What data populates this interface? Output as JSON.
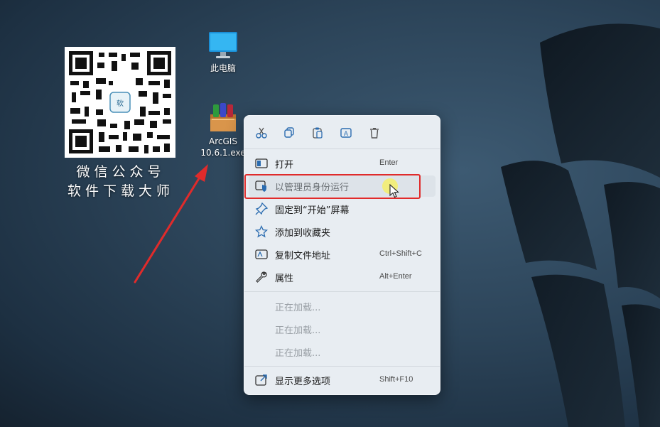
{
  "desktop": {
    "icons": [
      {
        "label": "此电脑"
      },
      {
        "label_line1": "ArcGIS",
        "label_line2": "10.6.1.exe"
      }
    ],
    "qr_caption_line1": "微信公众号",
    "qr_caption_line2": "软件下载大师"
  },
  "context_menu": {
    "toolbar": [
      "cut-icon",
      "copy-icon",
      "paste-icon",
      "rename-icon",
      "delete-icon"
    ],
    "items": [
      {
        "label": "打开",
        "shortcut": "Enter",
        "icon": "app-window-icon"
      },
      {
        "label": "以管理员身份运行",
        "shortcut": "",
        "icon": "shield-icon"
      },
      {
        "label": "固定到“开始”屏幕",
        "shortcut": "",
        "icon": "pin-icon"
      },
      {
        "label": "添加到收藏夹",
        "shortcut": "",
        "icon": "star-icon"
      },
      {
        "label": "复制文件地址",
        "shortcut": "Ctrl+Shift+C",
        "icon": "copy-path-icon"
      },
      {
        "label": "属性",
        "shortcut": "Alt+Enter",
        "icon": "wrench-icon"
      },
      {
        "label": "正在加载...",
        "shortcut": ""
      },
      {
        "label": "正在加载...",
        "shortcut": ""
      },
      {
        "label": "正在加载...",
        "shortcut": ""
      },
      {
        "label": "显示更多选项",
        "shortcut": "Shift+F10",
        "icon": "more-options-icon"
      }
    ]
  },
  "colors": {
    "highlight_box": "#e02b2b",
    "arrow": "#e02b2b",
    "menu_background": "#e8edf2"
  }
}
